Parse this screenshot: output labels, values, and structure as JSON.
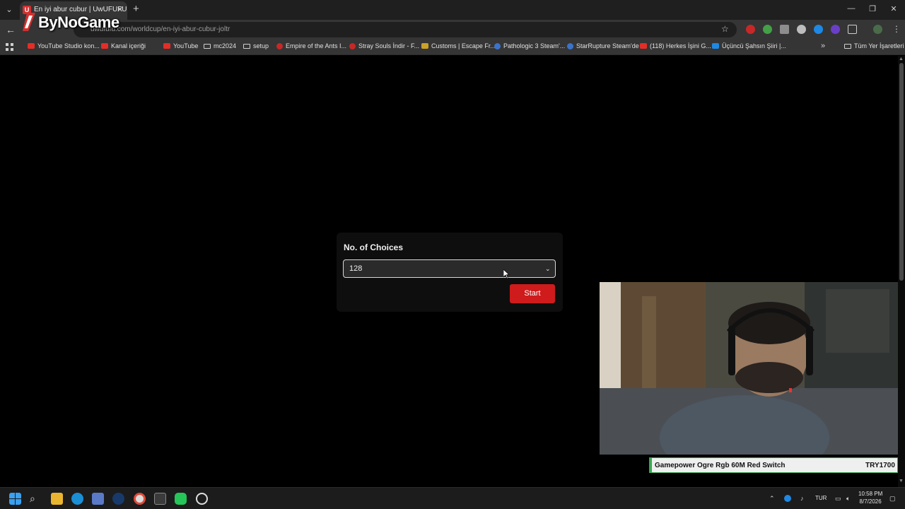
{
  "browser": {
    "tab": {
      "favicon_letter": "U",
      "title": "En iyi abur cubur | UwUFUFU",
      "close": "✕"
    },
    "new_tab": "+",
    "window_controls": {
      "minimize": "—",
      "maximize": "❐",
      "close": "✕"
    },
    "url": "uwufufu.com/worldcup/en-iyi-abur-cubur-joltr",
    "bookmarks": [
      {
        "label": "YouTube Studio kon...",
        "icon": "youtube-icon"
      },
      {
        "label": "Kanal içeriği",
        "icon": "youtube-icon"
      },
      {
        "label": "YouTube",
        "icon": "youtube-icon"
      },
      {
        "label": "mc2024",
        "icon": "folder-icon"
      },
      {
        "label": "setup",
        "icon": "folder-icon"
      },
      {
        "label": "Empire of the Ants I...",
        "icon": "site-icon"
      },
      {
        "label": "Stray Souls İndir - F...",
        "icon": "site-icon"
      },
      {
        "label": "Customs | Escape Fr...",
        "icon": "site-icon"
      },
      {
        "label": "Pathologic 3 Steam'...",
        "icon": "steam-icon"
      },
      {
        "label": "StarRupture Steam'de",
        "icon": "steam-icon"
      },
      {
        "label": "(118) Herkes İşini G...",
        "icon": "youtube-icon"
      },
      {
        "label": "Üçüncü Şahsın Şiiri |...",
        "icon": "site-icon"
      }
    ],
    "bookmarks_more": "»",
    "all_bookmarks": "Tüm Yer İşaretleri"
  },
  "watermark": {
    "text": "ByNoGame"
  },
  "page": {
    "card": {
      "label": "No. of Choices",
      "selected_value": "128",
      "start_label": "Start"
    }
  },
  "overlay": {
    "product_name": "Gamepower Ogre Rgb 60M Red Switch",
    "product_price": "TRY1700"
  },
  "taskbar": {
    "lang": "TUR",
    "time": "10:58 PM",
    "date": "8/7/2026"
  }
}
